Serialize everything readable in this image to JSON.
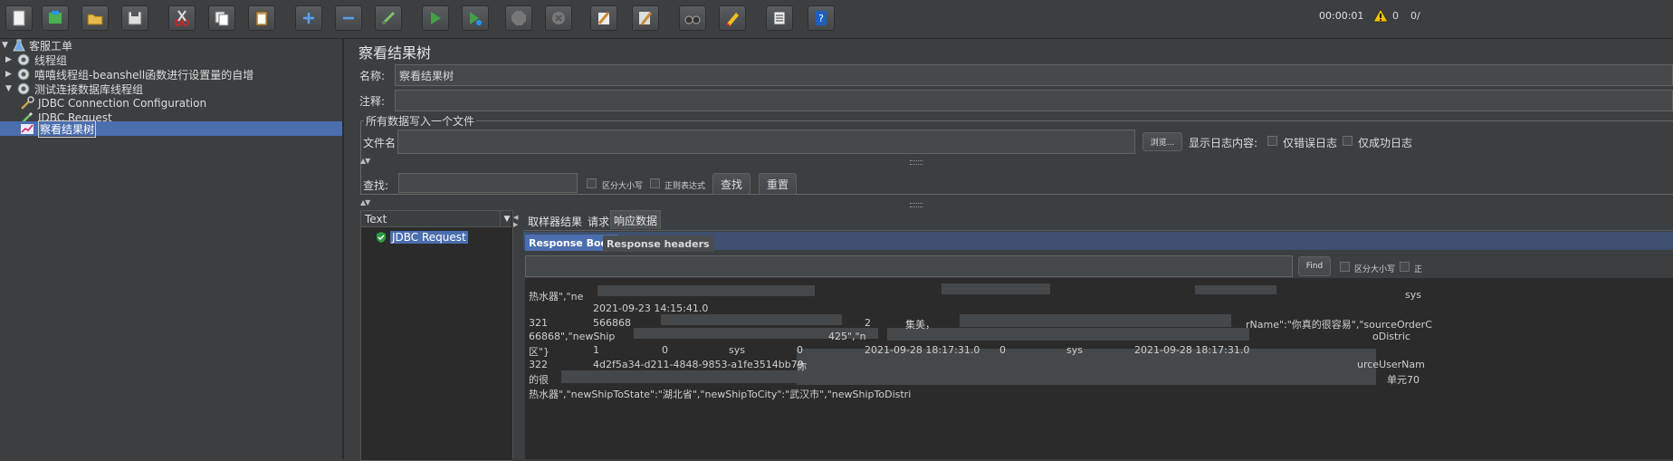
{
  "toolbar": {
    "timer": "00:00:01",
    "warning_count": "0",
    "active_threads": "0/"
  },
  "tree": {
    "items": [
      {
        "label": "客服工单",
        "level": 0,
        "expanded": true
      },
      {
        "label": "线程组",
        "level": 1,
        "expanded": false
      },
      {
        "label": "嘻嘻线程组-beanshell函数进行设置量的自增",
        "level": 1,
        "expanded": false
      },
      {
        "label": "测试连接数据库线程组",
        "level": 1,
        "expanded": true
      },
      {
        "label": "JDBC Connection Configuration",
        "level": 2
      },
      {
        "label": "JDBC Request",
        "level": 2
      },
      {
        "label": "察看结果树",
        "level": 2,
        "selected": true
      }
    ]
  },
  "panel": {
    "title": "察看结果树",
    "name_label": "名称:",
    "name_value": "察看结果树",
    "comment_label": "注释:",
    "file_group_legend": "所有数据写入一个文件",
    "filename_label": "文件名",
    "browse_button": "浏览...",
    "log_label": "显示日志内容:",
    "errors_only": "仅错误日志",
    "success_only": "仅成功日志",
    "search_label": "查找:",
    "case_sensitive": "区分大小写",
    "regex": "正则表达式",
    "find_button": "查找",
    "reset_button": "重置"
  },
  "results": {
    "column_header": "Text",
    "items": [
      "JDBC Request"
    ]
  },
  "detail": {
    "tabs": [
      "取样器结果",
      "请求",
      "响应数据"
    ],
    "active_tab": "响应数据",
    "subtabs": [
      "Response Body",
      "Response headers"
    ],
    "find_button": "Find",
    "case_label": "区分大小写",
    "case_label_2": "正",
    "lines": [
      {
        "a": "热水器\",\"ne",
        "b": "",
        "c": "sys"
      },
      {
        "a": "",
        "b": "2021-09-23 14:15:41.0"
      },
      {
        "a": "321",
        "b": "566868",
        "c": "2",
        "d": "集美，",
        "e": "rName\":\"你真的很容易\",\"sourceOrderC"
      },
      {
        "a": "66868\",\"newShip",
        "b": "425\",\"n",
        "e": "oDistric"
      },
      {
        "a": "区\"}",
        "b": "1",
        "c": "0",
        "d": "sys",
        "f": "0",
        "g": "2021-09-28 18:17:31.0",
        "h": "0",
        "i": "sys",
        "j": "2021-09-28 18:17:31.0"
      },
      {
        "a": "322",
        "b": "4d2f5a34-d211-4848-9853-a1fe3514bb79",
        "c": "你",
        "e": "urceUserNam"
      },
      {
        "a": "的很",
        "e": "单元70"
      },
      {
        "a": "热水器\",\"newShipToState\":\"湖北省\",\"newShipToCity\":\"武汉市\",\"newShipToDistri"
      }
    ]
  }
}
